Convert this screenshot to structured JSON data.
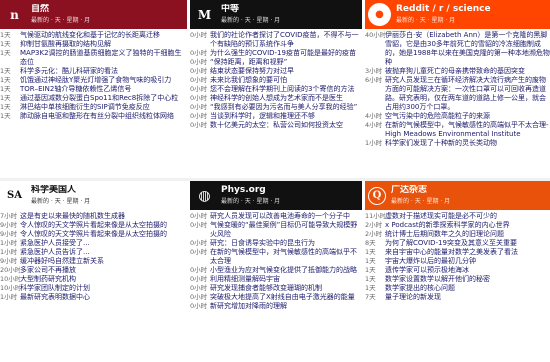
{
  "panels": [
    {
      "title": "自然",
      "subtitle": "最新的 · 天 · 星期 · 月",
      "logo_text": "n",
      "header_bg": "#8b1020",
      "header_fg": "#ffffff",
      "items": [
        {
          "time": "1天",
          "headline": "气候驱动的航线变化和基于记忆的长距离迁移",
          "lines": 2
        },
        {
          "time": "1天",
          "headline": "抑制甘氨酸再摄取的结构见解",
          "lines": 1
        },
        {
          "time": "1天",
          "headline": "MAP3K2调控的肠道基质细胞定义了独特的干细胞生态位",
          "lines": 2
        },
        {
          "time": "1天",
          "headline": "科学多元化：酷儿科研家的看法",
          "lines": 1
        },
        {
          "time": "1天",
          "headline": "饥饿通过神经肽Y聚光灯增强了食物气味的吸引力",
          "lines": 2
        },
        {
          "time": "1天",
          "headline": "TOR–EIN2轴介导糖依赖性乙烯信号",
          "lines": 1
        },
        {
          "time": "1天",
          "headline": "通过基因减数分裂蛋白Spo11和Rec8拆除了中心粒",
          "lines": 2
        },
        {
          "time": "1天",
          "headline": "淋巴结中单核细胞衍生的SIP调节免疫反应",
          "lines": 1
        },
        {
          "time": "1天",
          "headline": "肺动脉自电驱和整形在有丝分裂中组织线粒体网络",
          "lines": 2
        }
      ]
    },
    {
      "title": "中等",
      "subtitle": "最新的 · 天 · 星期 · 月",
      "logo_text": "M",
      "header_bg": "#111111",
      "header_fg": "#ffffff",
      "items": [
        {
          "time": "0小时",
          "headline": "我们的社论作者探讨了COVID疫苗，不得不与一个有缺陷的预订系统作斗争",
          "lines": 2
        },
        {
          "time": "0小时",
          "headline": "为什么强生的COVID-19疫苗可能是最好的疫苗",
          "lines": 2
        },
        {
          "time": "0小时",
          "headline": "“保持距离，距离和视野”",
          "lines": 1
        },
        {
          "time": "0小时",
          "headline": "结束状态要保持努力对过早",
          "lines": 1
        },
        {
          "time": "0小时",
          "headline": "未来比我们想象的要可怕",
          "lines": 1
        },
        {
          "time": "0小时",
          "headline": "您不会理解在科学期刊上阅读的3个寄信的方法",
          "lines": 2
        },
        {
          "time": "0小时",
          "headline": "神经科学的创始人想成为艺术家而不是医生",
          "lines": 1
        },
        {
          "time": "0小时",
          "headline": "“我感到有必要因为污名而与美人分享我的经验”",
          "lines": 2
        },
        {
          "time": "0小时",
          "headline": "当谈到科学时，逻辑和推理还不够",
          "lines": 1
        },
        {
          "time": "0小时",
          "headline": "数十亿美元的太空：私营公司如何投资太空",
          "lines": 1
        }
      ]
    },
    {
      "title": "Reddit / r / science",
      "subtitle": "最新的 · 天 · 星期 · 月",
      "logo_text": "●",
      "header_bg": "#ff4500",
      "header_fg": "#ffffff",
      "items": [
        {
          "time": "40小时",
          "headline": "伊丽莎白·安（Elizabeth Ann）是第一个克隆的黑脚雪貂，它是由30多年前死亡的雪貂的冷冻细胞制成的，她是1988年以来在美国克隆的第一种本地濒危物种",
          "lines": 4
        },
        {
          "time": "3小时",
          "headline": "被抛弃狗儿童死亡的母亲携带致命的基因突变",
          "lines": 2
        },
        {
          "time": "6小时",
          "headline": "研究人员发现三在循环经济解决大流行病产生的废物方面的可能解决方案：一次性口罩可以可回收再造道路。研究表明，仅在两车道的道路上修一公里，就会占用约300万个口罩。",
          "lines": 5
        },
        {
          "time": "4小时",
          "headline": "空气污染中的危险高能粒子的来源",
          "lines": 1
        },
        {
          "time": "4小时",
          "headline": "在新的气候模型中，气候敏感性的高端似乎不太合理-High Meadows Environmental Institute",
          "lines": 3
        },
        {
          "time": "1小时",
          "headline": "科学家们发现了十种新的灵长类动物",
          "lines": 1
        }
      ]
    },
    {
      "title": "科学美国人",
      "subtitle": "最新的 · 天 · 星期 · 月",
      "logo_text": "SA",
      "header_bg": "#ffffff",
      "header_fg": "#111111",
      "items": [
        {
          "time": "7小时",
          "headline": "这是有史以来最快的随机数生成器",
          "lines": 1
        },
        {
          "time": "9小时",
          "headline": "令人惊叹的天文学照片看起来像是从太空拍摄的",
          "lines": 2
        },
        {
          "time": "9小时",
          "headline": "令人惊叹的天文学照片看起来像是从太空拍摄的",
          "lines": 2
        },
        {
          "time": "1小时",
          "headline": "紧急医护人员接受了...",
          "lines": 1
        },
        {
          "time": "1小时",
          "headline": "紧急医护人员告诉了...",
          "lines": 1
        },
        {
          "time": "9小时",
          "headline": "缓冲器好吗自然建立新关系",
          "lines": 1
        },
        {
          "time": "20小时",
          "headline": "多家公司不再播放",
          "lines": 1
        },
        {
          "time": "10小时",
          "headline": "大型制药研究机构",
          "lines": 1
        },
        {
          "time": "10小时",
          "headline": "科学家团队制定的计划",
          "lines": 1
        },
        {
          "time": "1小时",
          "headline": "最新研究表明数据中心",
          "lines": 1
        }
      ]
    },
    {
      "title": "Phys.org",
      "subtitle": "最新的 · 天 · 星期 · 月",
      "logo_text": "◍",
      "header_bg": "#111111",
      "header_fg": "#ffffff",
      "items": [
        {
          "time": "0小时",
          "headline": "研究人员发现可以改善电池寿命的一个分子中",
          "lines": 1
        },
        {
          "time": "0小时",
          "headline": "气候变暖的“最佳案例”目标仍可能导致大规模野火风险",
          "lines": 2
        },
        {
          "time": "0小时",
          "headline": "研究：日食诱导实验中的昆虫行为",
          "lines": 1
        },
        {
          "time": "0小时",
          "headline": "在新的气候模型中，对气候敏感性的高端似乎不太合理",
          "lines": 2
        },
        {
          "time": "0小时",
          "headline": "小型渔业为应对气候变化提供了抵御能力的战略",
          "lines": 2
        },
        {
          "time": "0小时",
          "headline": "利用精细测量解码宇宙",
          "lines": 1
        },
        {
          "time": "0小时",
          "headline": "研究发现捕食者能够改变珊瑚的机制",
          "lines": 1
        },
        {
          "time": "0小时",
          "headline": "突破极大地提高了X射线自由电子激光器的能量",
          "lines": 2
        },
        {
          "time": "0小时",
          "headline": "新研究增加对降雨的理解",
          "lines": 1
        }
      ]
    },
    {
      "title": "广达杂志",
      "subtitle": "最新的 · 天 · 星期 · 月",
      "logo_text": "Q",
      "header_bg": "#e8520a",
      "header_fg": "#ffffff",
      "items": [
        {
          "time": "11小时",
          "headline": "虚数对于描述现实可能是必不可少的",
          "lines": 1
        },
        {
          "time": "2小时",
          "headline": "x Podcast的新季探索科学家的内心世界",
          "lines": 1
        },
        {
          "time": "2小时",
          "headline": "统计博士后期间数年之久的旧理论问题",
          "lines": 1
        },
        {
          "time": "8天",
          "headline": "为何了解COVID-19突变及其意义至关重要",
          "lines": 1
        },
        {
          "time": "1天",
          "headline": "来自宇宙中心的能量对数学之美发表了看法",
          "lines": 2
        },
        {
          "time": "1天",
          "headline": "宇宙大爆炸以后的最初几分钟",
          "lines": 1
        },
        {
          "time": "1天",
          "headline": "遗传学家可以预示极地海冰",
          "lines": 1
        },
        {
          "time": "1天",
          "headline": "数学家设置数学以解开他们的秘密",
          "lines": 1
        },
        {
          "time": "1天",
          "headline": "数学家提出的核心问题",
          "lines": 1
        },
        {
          "time": "7天",
          "headline": "量子理论的新发现",
          "lines": 1
        }
      ]
    }
  ]
}
